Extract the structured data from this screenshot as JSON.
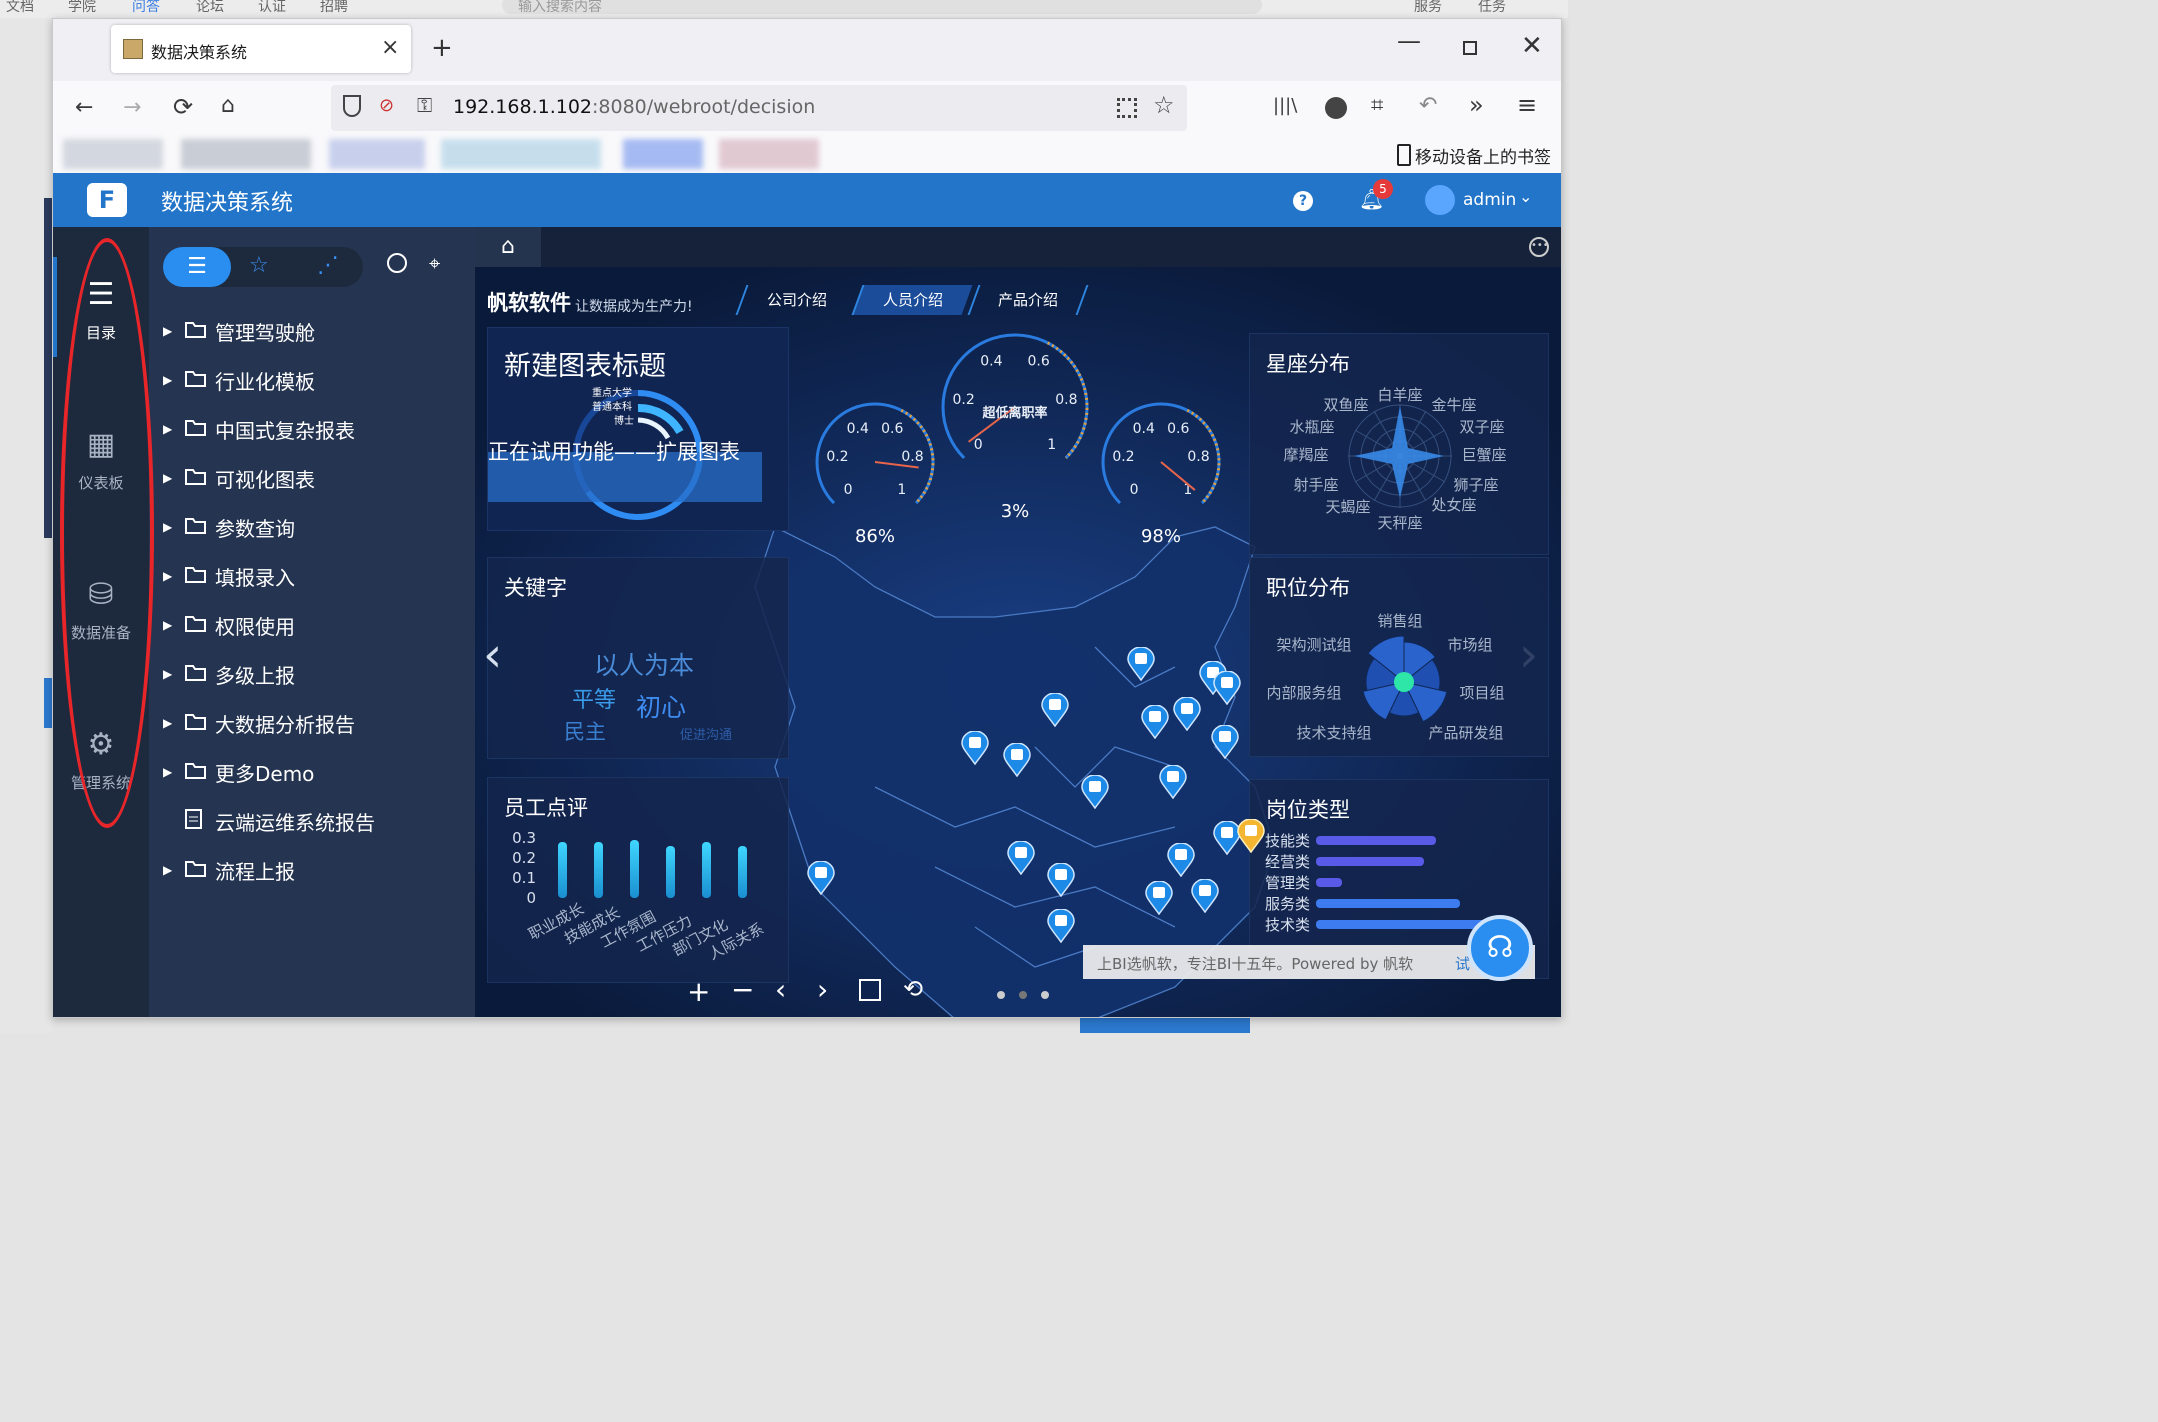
{
  "background": {
    "top_links": [
      "文档",
      "学院",
      "问答",
      "论坛",
      "认证",
      "招聘"
    ],
    "search_placeholder": "输入搜索内容",
    "right_links": [
      "服务",
      "任务"
    ]
  },
  "browser": {
    "tab_title": "数据决策系统",
    "url_host": "192.168.1.102",
    "url_rest": ":8080/webroot/decision",
    "mobile_bookmarks": "移动设备上的书签"
  },
  "app": {
    "title": "数据决策系统",
    "notification_count": "5",
    "user": "admin",
    "left_nav": [
      {
        "label": "目录",
        "icon": "list-icon"
      },
      {
        "label": "仪表板",
        "icon": "dashboard-icon"
      },
      {
        "label": "数据准备",
        "icon": "database-icon"
      },
      {
        "label": "管理系统",
        "icon": "gear-icon"
      }
    ],
    "catalog": [
      {
        "label": "管理驾驶舱",
        "type": "folder"
      },
      {
        "label": "行业化模板",
        "type": "folder"
      },
      {
        "label": "中国式复杂报表",
        "type": "folder"
      },
      {
        "label": "可视化图表",
        "type": "folder"
      },
      {
        "label": "参数查询",
        "type": "folder"
      },
      {
        "label": "填报录入",
        "type": "folder"
      },
      {
        "label": "权限使用",
        "type": "folder"
      },
      {
        "label": "多级上报",
        "type": "folder"
      },
      {
        "label": "大数据分析报告",
        "type": "folder"
      },
      {
        "label": "更多Demo",
        "type": "folder"
      },
      {
        "label": "云端运维系统报告",
        "type": "file"
      },
      {
        "label": "流程上报",
        "type": "folder"
      }
    ]
  },
  "dashboard": {
    "brand": "帆软软件",
    "slogan": "让数据成为生产力!",
    "tabs": [
      "公司介绍",
      "人员介绍",
      "产品介绍"
    ],
    "active_tab": 1,
    "new_chart_title": "新建图表标题",
    "trial_notice": "正在试用功能——扩展图表",
    "ring_labels": [
      "重点大学",
      "普通本科",
      "博士"
    ],
    "gauges": [
      {
        "value": "86%",
        "ticks": [
          "0",
          "0.2",
          "0.4",
          "0.6",
          "0.8",
          "1"
        ],
        "label": ""
      },
      {
        "value": "3%",
        "ticks": [
          "0",
          "0.2",
          "0.4",
          "0.6",
          "0.8",
          "1"
        ],
        "label": "超低离职率"
      },
      {
        "value": "98%",
        "ticks": [
          "0",
          "0.2",
          "0.4",
          "0.6",
          "0.8",
          "1"
        ],
        "label": ""
      }
    ],
    "keyword_title": "关键字",
    "keywords": [
      "以人为本",
      "平等",
      "初心",
      "民主",
      "促进沟通"
    ],
    "review_title": "员工点评",
    "review_yticks": [
      "0.3",
      "0.2",
      "0.1",
      "0"
    ],
    "review_categories": [
      "职业成长",
      "技能成长",
      "工作氛围",
      "工作压力",
      "部门文化",
      "人际关系"
    ],
    "review_values": [
      0.28,
      0.28,
      0.29,
      0.26,
      0.28,
      0.26
    ],
    "constellation_title": "星座分布",
    "constellations": [
      "白羊座",
      "金牛座",
      "双子座",
      "巨蟹座",
      "狮子座",
      "处女座",
      "天秤座",
      "天蝎座",
      "射手座",
      "摩羯座",
      "水瓶座",
      "双鱼座"
    ],
    "position_title": "职位分布",
    "positions": [
      "销售组",
      "市场组",
      "项目组",
      "产品研发组",
      "技术支持组",
      "内部服务组",
      "架构测试组"
    ],
    "jobtype_title": "岗位类型",
    "jobtypes": [
      {
        "label": "技能类",
        "value": 0.6
      },
      {
        "label": "经营类",
        "value": 0.54
      },
      {
        "label": "管理类",
        "value": 0.13
      },
      {
        "label": "服务类",
        "value": 0.72
      },
      {
        "label": "技术类",
        "value": 0.9
      }
    ],
    "footer_text": "上BI选帆软，专注BI十五年。Powered by 帆软",
    "footer_link": "试"
  },
  "colors": {
    "header_blue": "#2275c8",
    "nav_dark": "#1d2a3e",
    "catalog_bg": "#253450",
    "dashboard_bg": "#0d2247",
    "annotation_red": "#e8262a"
  }
}
